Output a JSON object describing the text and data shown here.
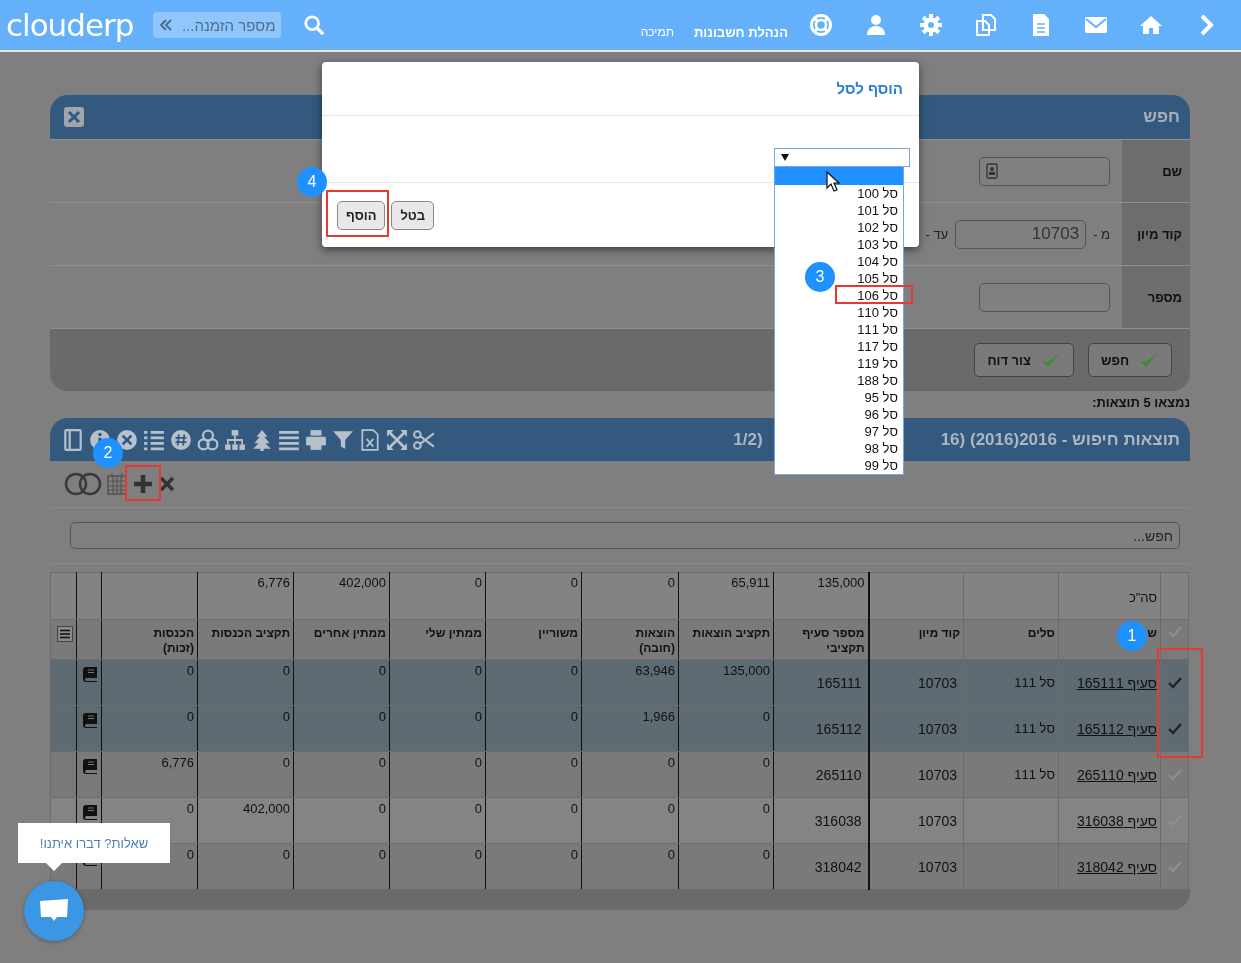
{
  "top_bar": {
    "logo": "clouderp",
    "search": {
      "placeholder": "מספר הזמנה..."
    },
    "nav": [
      {
        "label": "הנהלת חשבונות",
        "selected": true
      },
      {
        "label": "תמיכה",
        "selected": false
      }
    ]
  },
  "search_panel": {
    "title": "חפש",
    "fields": [
      {
        "label": "שם",
        "kind": "contact"
      },
      {
        "label": "קוד מיון",
        "kind": "range",
        "from_label": "מ -",
        "value": "10703",
        "to_label": "עד -"
      },
      {
        "label": "מספר",
        "kind": "text"
      }
    ],
    "buttons": [
      "חפש",
      "צור דוח"
    ]
  },
  "results_count": "נמצאו 5 תוצאות:",
  "results": {
    "title": "תוצאות חיפוש - 2016(2016) (16",
    "title_tail": "(1/2",
    "search": {
      "placeholder": "חפש..."
    },
    "table": {
      "columns": [
        "ש",
        "סלים",
        "קוד מיון",
        "מספר סעיף\nתקציבי",
        "תקציב הוצאות",
        "הוצאות\n(חובה)",
        "משוריין",
        "ממתין שלי",
        "ממתין אחרים",
        "תקציב הכנסות",
        "הכנסות\n(זכות)"
      ],
      "totals": {
        "label": "סה\"כ",
        "values": [
          "135,000",
          "65,911",
          "0",
          "0",
          "0",
          "402,000",
          "6,776"
        ]
      },
      "rows": [
        {
          "selected": true,
          "name": "סעיף 165111",
          "basket": "סל 111",
          "sort_code": "10703",
          "budget_item": "165111",
          "values": [
            "135,000",
            "63,946",
            "0",
            "0",
            "0",
            "0",
            "0"
          ]
        },
        {
          "selected": true,
          "name": "סעיף 165112",
          "basket": "סל 111",
          "sort_code": "10703",
          "budget_item": "165112",
          "values": [
            "0",
            "1,966",
            "0",
            "0",
            "0",
            "0",
            "0"
          ]
        },
        {
          "selected": false,
          "name": "סעיף 265110",
          "basket": "סל 111",
          "sort_code": "10703",
          "budget_item": "265110",
          "values": [
            "0",
            "0",
            "0",
            "0",
            "0",
            "0",
            "6,776"
          ]
        },
        {
          "selected": false,
          "name": "סעיף 316038",
          "sort_code": "10703",
          "budget_item": "316038",
          "values": [
            "0",
            "0",
            "0",
            "0",
            "0",
            "402,000",
            "0"
          ]
        },
        {
          "selected": false,
          "name": "סעיף 318042",
          "sort_code": "10703",
          "budget_item": "318042",
          "values": [
            "0",
            "0",
            "0",
            "0",
            "0",
            "0",
            "0"
          ]
        }
      ]
    }
  },
  "dialog": {
    "title": "הוסף לסל",
    "select": {
      "options": [
        {
          "highlighted": true
        },
        {
          "label": "סל 100",
          "highlighted": false
        },
        {
          "label": "סל 101",
          "highlighted": false
        },
        {
          "label": "סל 102",
          "highlighted": false
        },
        {
          "label": "סל 103",
          "highlighted": false
        },
        {
          "label": "סל 104",
          "highlighted": false
        },
        {
          "label": "סל 105",
          "highlighted": false
        },
        {
          "label": "סל 106",
          "highlighted": false
        },
        {
          "label": "סל 110",
          "highlighted": false
        },
        {
          "label": "סל 111",
          "highlighted": false
        },
        {
          "label": "סל 117",
          "highlighted": false
        },
        {
          "label": "סל 119",
          "highlighted": false
        },
        {
          "label": "סל 188",
          "highlighted": false
        },
        {
          "label": "סל 95",
          "highlighted": false
        },
        {
          "label": "סל 96",
          "highlighted": false
        },
        {
          "label": "סל 97",
          "highlighted": false
        },
        {
          "label": "סל 98",
          "highlighted": false
        },
        {
          "label": "סל 99",
          "highlighted": false
        }
      ]
    },
    "buttons": [
      "בטל",
      "הוסף"
    ]
  },
  "markers": [
    "1",
    "2",
    "3",
    "4"
  ],
  "chat": {
    "prompt": "שאלות? דברו איתנו!"
  }
}
